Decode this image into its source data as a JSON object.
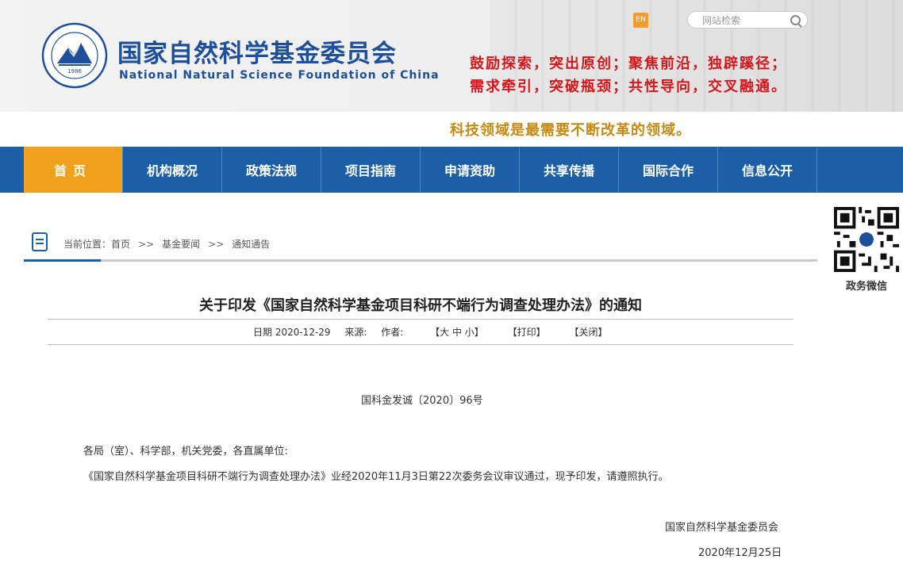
{
  "header": {
    "org_name_cn": "国家自然科学基金委员会",
    "org_name_en": "National Natural Science Foundation of China",
    "logo_year": "1986",
    "slogan_line1": "鼓励探索，突出原创；聚焦前沿，独辟蹊径；",
    "slogan_line2": "需求牵引，突破瓶颈；共性导向，交叉融通。",
    "en_switch": "EN",
    "search_placeholder": "网站检索",
    "tagline": "科技领域是最需要不断改革的领域。"
  },
  "nav": {
    "items": [
      {
        "label": "首页",
        "active": true
      },
      {
        "label": "机构概况"
      },
      {
        "label": "政策法规"
      },
      {
        "label": "项目指南"
      },
      {
        "label": "申请资助"
      },
      {
        "label": "共享传播"
      },
      {
        "label": "国际合作"
      },
      {
        "label": "信息公开"
      }
    ]
  },
  "qr": {
    "label": "政务微信"
  },
  "breadcrumb": {
    "prefix": "当前位置：",
    "items": [
      "首页",
      "基金要闻",
      "通知通告"
    ],
    "separator": ">>"
  },
  "article": {
    "title": "关于印发《国家自然科学基金项目科研不端行为调查处理办法》的通知",
    "meta": {
      "date": "日期 2020-12-29",
      "source": "来源:",
      "author": "作者:",
      "font_size": "【大 中 小】",
      "print": "【打印】",
      "close": "【关闭】"
    },
    "doc_number": "国科金发诚〔2020〕96号",
    "addressee": "各局（室）、科学部，机关党委，各直属单位:",
    "paragraph": "《国家自然科学基金项目科研不端行为调查处理办法》业经2020年11月3日第22次委务会议审议通过，现予印发，请遵照执行。",
    "signature": "国家自然科学基金委员会",
    "sign_date": "2020年12月25日"
  },
  "colors": {
    "brand_blue": "#1d5fa6",
    "nav_active": "#f2a11f",
    "slogan_red": "#d6161b",
    "tagline_gold": "#c58a13"
  }
}
